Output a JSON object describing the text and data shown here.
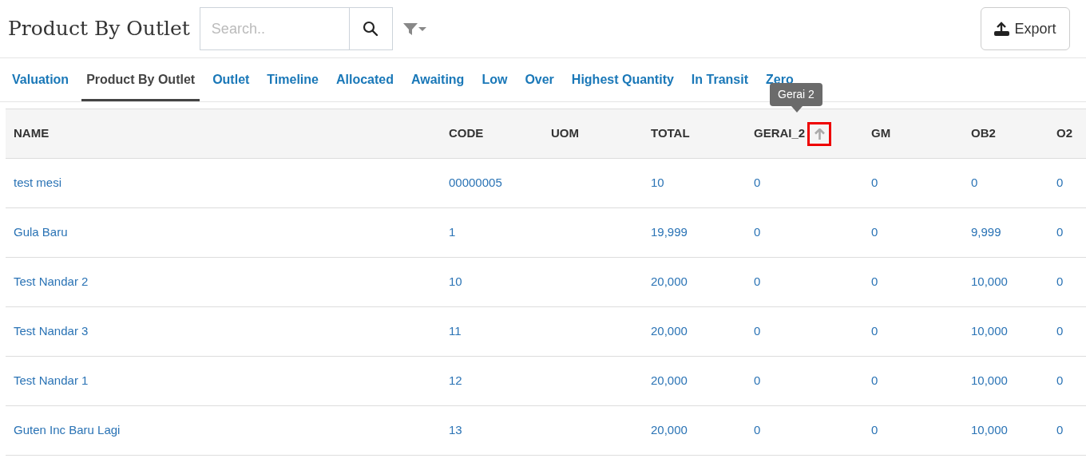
{
  "page_title": "Product By Outlet",
  "search": {
    "placeholder": "Search.."
  },
  "export_button": "Export",
  "tabs": [
    {
      "label": "Valuation",
      "selected": false
    },
    {
      "label": "Product By Outlet",
      "selected": true
    },
    {
      "label": "Outlet",
      "selected": false
    },
    {
      "label": "Timeline",
      "selected": false
    },
    {
      "label": "Allocated",
      "selected": false
    },
    {
      "label": "Awaiting",
      "selected": false
    },
    {
      "label": "Low",
      "selected": false
    },
    {
      "label": "Over",
      "selected": false
    },
    {
      "label": "Highest Quantity",
      "selected": false
    },
    {
      "label": "In Transit",
      "selected": false
    },
    {
      "label": "Zero",
      "selected": false
    }
  ],
  "tooltip": "Gerai 2",
  "table": {
    "columns": [
      {
        "label": "NAME",
        "sortable": false
      },
      {
        "label": "CODE",
        "sortable": false
      },
      {
        "label": "UOM",
        "sortable": false
      },
      {
        "label": "TOTAL",
        "sortable": false
      },
      {
        "label": "GERAI_2",
        "sortable": true
      },
      {
        "label": "GM",
        "sortable": false
      },
      {
        "label": "OB2",
        "sortable": false
      },
      {
        "label": "O2",
        "sortable": false
      }
    ],
    "rows": [
      [
        "test mesi",
        "00000005",
        "",
        "10",
        "0",
        "0",
        "0",
        "0"
      ],
      [
        "Gula Baru",
        "1",
        "",
        "19,999",
        "0",
        "0",
        "9,999",
        "0"
      ],
      [
        "Test Nandar 2",
        "10",
        "",
        "20,000",
        "0",
        "0",
        "10,000",
        "0"
      ],
      [
        "Test Nandar 3",
        "11",
        "",
        "20,000",
        "0",
        "0",
        "10,000",
        "0"
      ],
      [
        "Test Nandar 1",
        "12",
        "",
        "20,000",
        "0",
        "0",
        "10,000",
        "0"
      ],
      [
        "Guten Inc Baru Lagi",
        "13",
        "",
        "20,000",
        "0",
        "0",
        "10,000",
        "0"
      ]
    ]
  }
}
